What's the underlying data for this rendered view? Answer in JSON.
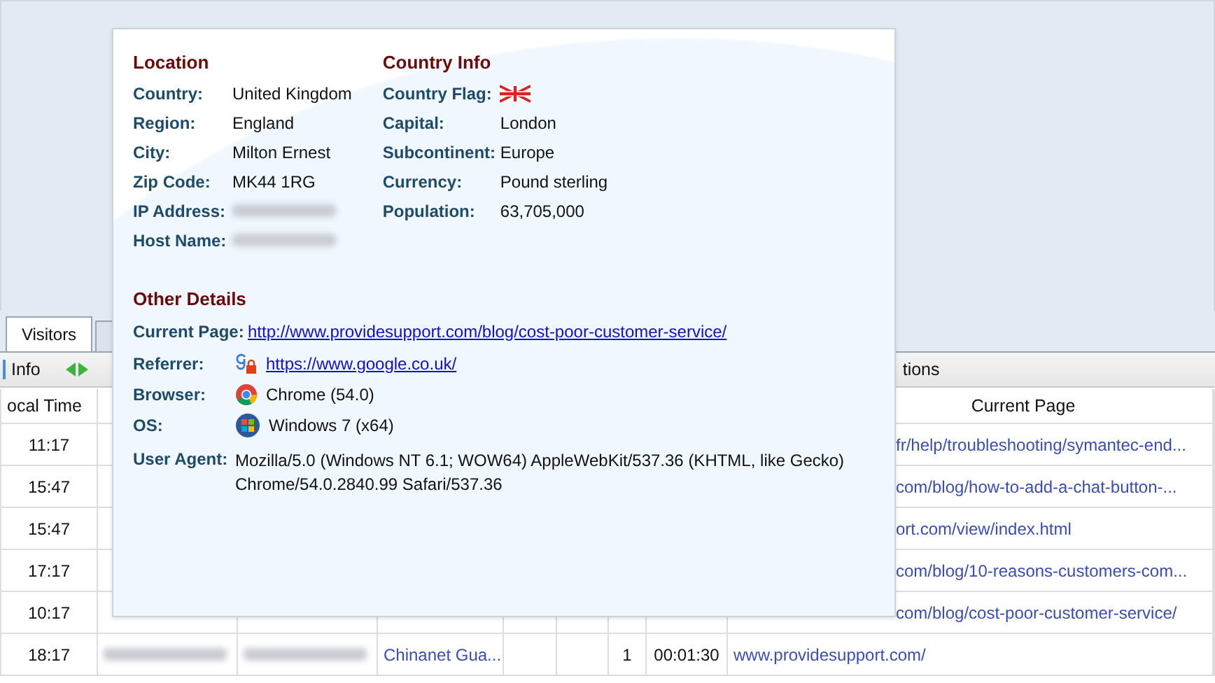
{
  "tabs": [
    {
      "label": "Visitors",
      "selected": true
    },
    {
      "selected": false
    }
  ],
  "toolbar": {
    "label": "Info",
    "label_2": "tions"
  },
  "table": {
    "columns": [
      "ocal Time",
      "Current Page"
    ],
    "rows": [
      {
        "local_time": "11:17",
        "current_page": "fr/help/troubleshooting/symantec-end...",
        "covered": true
      },
      {
        "local_time": "15:47",
        "current_page": "com/blog/how-to-add-a-chat-button-...",
        "covered": true
      },
      {
        "local_time": "15:47",
        "current_page": "ort.com/view/index.html",
        "covered": true
      },
      {
        "local_time": "17:17",
        "current_page": "com/blog/10-reasons-customers-com...",
        "covered": true
      },
      {
        "local_time": "10:17",
        "current_page": "com/blog/cost-poor-customer-service/",
        "covered": true
      },
      {
        "local_time": "18:17",
        "ip_blurred": true,
        "host_blurred": true,
        "isp": "Chinanet Gua...",
        "count": "1",
        "duration": "00:01:30",
        "current_page": "www.providesupport.com/",
        "covered": false
      }
    ]
  },
  "popup": {
    "location": {
      "title": "Location",
      "fields": [
        {
          "label": "Country:",
          "value": "United Kingdom"
        },
        {
          "label": "Region:",
          "value": "England"
        },
        {
          "label": "City:",
          "value": "Milton Ernest"
        },
        {
          "label": "Zip Code:",
          "value": "MK44 1RG"
        },
        {
          "label": "IP Address:",
          "blurred": true
        },
        {
          "label": "Host Name:",
          "blurred": true
        }
      ]
    },
    "country_info": {
      "title": "Country Info",
      "fields": [
        {
          "label": "Country Flag:",
          "kind": "flag"
        },
        {
          "label": "Capital:",
          "kind": "text",
          "value": "London"
        },
        {
          "label": "Subcontinent:",
          "kind": "text",
          "value": "Europe"
        },
        {
          "label": "Currency:",
          "kind": "text",
          "value": "Pound sterling"
        },
        {
          "label": "Population:",
          "kind": "text",
          "value": "63,705,000"
        }
      ]
    },
    "other_details": {
      "title": "Other Details",
      "fields": [
        {
          "label": "Current Page:",
          "kind": "link",
          "value": "http://www.providesupport.com/blog/cost-poor-customer-service/"
        },
        {
          "label": "Referrer:",
          "kind": "icon_link",
          "value": "https://www.google.co.uk/"
        },
        {
          "label": "Browser:",
          "kind": "icon_text",
          "value": "Chrome (54.0)"
        },
        {
          "label": "OS:",
          "kind": "icon_text",
          "value": "Windows 7 (x64)"
        },
        {
          "label": "User Agent:",
          "kind": "text",
          "value": "Mozilla/5.0 (Windows NT 6.1; WOW64) AppleWebKit/537.36 (KHTML, like Gecko) Chrome/54.0.2840.99 Safari/537.36"
        }
      ]
    }
  }
}
